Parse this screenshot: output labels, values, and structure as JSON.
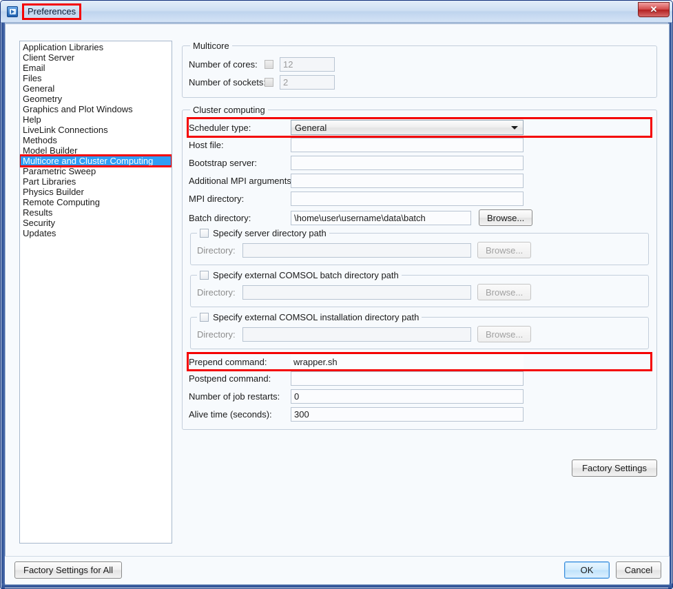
{
  "window": {
    "title": "Preferences",
    "icon": "comsol-app-icon",
    "close_label": "✕"
  },
  "sidebar": {
    "items": [
      {
        "label": "Application Libraries",
        "selected": false
      },
      {
        "label": "Client Server",
        "selected": false
      },
      {
        "label": "Email",
        "selected": false
      },
      {
        "label": "Files",
        "selected": false
      },
      {
        "label": "General",
        "selected": false
      },
      {
        "label": "Geometry",
        "selected": false
      },
      {
        "label": "Graphics and Plot Windows",
        "selected": false
      },
      {
        "label": "Help",
        "selected": false
      },
      {
        "label": "LiveLink Connections",
        "selected": false
      },
      {
        "label": "Methods",
        "selected": false
      },
      {
        "label": "Model Builder",
        "selected": false
      },
      {
        "label": "Multicore and Cluster Computing",
        "selected": true
      },
      {
        "label": "Parametric Sweep",
        "selected": false
      },
      {
        "label": "Part Libraries",
        "selected": false
      },
      {
        "label": "Physics Builder",
        "selected": false
      },
      {
        "label": "Remote Computing",
        "selected": false
      },
      {
        "label": "Results",
        "selected": false
      },
      {
        "label": "Security",
        "selected": false
      },
      {
        "label": "Updates",
        "selected": false
      }
    ]
  },
  "multicore": {
    "legend": "Multicore",
    "cores_label": "Number of cores:",
    "cores_value": "12",
    "cores_checked": false,
    "sockets_label": "Number of sockets:",
    "sockets_value": "2",
    "sockets_checked": false
  },
  "cluster": {
    "legend": "Cluster computing",
    "scheduler_label": "Scheduler type:",
    "scheduler_value": "General",
    "host_file_label": "Host file:",
    "host_file_value": "",
    "bootstrap_label": "Bootstrap server:",
    "bootstrap_value": "",
    "mpi_args_label": "Additional MPI arguments:",
    "mpi_args_value": "",
    "mpi_dir_label": "MPI directory:",
    "mpi_dir_value": "",
    "batch_dir_label": "Batch directory:",
    "batch_dir_value": "\\home\\user\\username\\data\\batch",
    "batch_browse_label": "Browse...",
    "server_dir": {
      "checkbox_label": "Specify server directory path",
      "checked": false,
      "dir_label": "Directory:",
      "dir_value": "",
      "browse_label": "Browse..."
    },
    "batch_ext_dir": {
      "checkbox_label": "Specify external COMSOL batch directory path",
      "checked": false,
      "dir_label": "Directory:",
      "dir_value": "",
      "browse_label": "Browse..."
    },
    "install_ext_dir": {
      "checkbox_label": "Specify external COMSOL installation directory path",
      "checked": false,
      "dir_label": "Directory:",
      "dir_value": "",
      "browse_label": "Browse..."
    },
    "prepend_label": "Prepend command:",
    "prepend_value": "wrapper.sh",
    "postpend_label": "Postpend command:",
    "postpend_value": "",
    "restarts_label": "Number of job restarts:",
    "restarts_value": "0",
    "alive_label": "Alive time (seconds):",
    "alive_value": "300"
  },
  "buttons": {
    "factory_settings": "Factory Settings",
    "factory_settings_all": "Factory Settings for All",
    "ok": "OK",
    "cancel": "Cancel"
  },
  "highlight_color": "#f40000",
  "selection_color": "#2f9ef5"
}
